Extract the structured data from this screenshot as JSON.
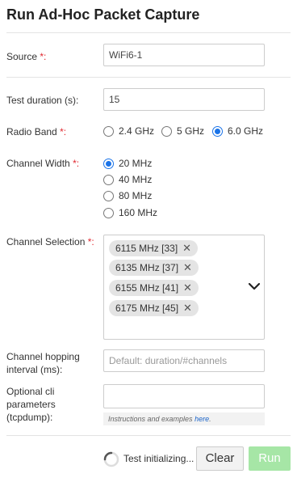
{
  "title": "Run Ad-Hoc Packet Capture",
  "source": {
    "label": "Source",
    "required_mark": "*:",
    "value": "WiFi6-1"
  },
  "duration": {
    "label": "Test duration (s):",
    "value": "15"
  },
  "radio_band": {
    "label": "Radio Band",
    "required_mark": "*:",
    "options": [
      {
        "label": "2.4 GHz",
        "checked": false
      },
      {
        "label": "5 GHz",
        "checked": false
      },
      {
        "label": "6.0 GHz",
        "checked": true
      }
    ]
  },
  "channel_width": {
    "label": "Channel Width",
    "required_mark": "*:",
    "options": [
      {
        "label": "20 MHz",
        "checked": true
      },
      {
        "label": "40 MHz",
        "checked": false
      },
      {
        "label": "80 MHz",
        "checked": false
      },
      {
        "label": "160 MHz",
        "checked": false
      }
    ]
  },
  "channel_selection": {
    "label": "Channel Selection",
    "required_mark": "*:",
    "chips": [
      "6115 MHz [33]",
      "6135 MHz [37]",
      "6155 MHz [41]",
      "6175 MHz [45]"
    ]
  },
  "hopping": {
    "label_line1": "Channel hopping",
    "label_line2": "interval (ms):",
    "placeholder": "Default: duration/#channels"
  },
  "cli": {
    "label_line1": "Optional cli",
    "label_line2": "parameters",
    "label_line3": "(tcpdump):",
    "value": "",
    "hint_text": "Instructions and examples ",
    "hint_link": "here",
    "hint_end": "."
  },
  "footer": {
    "status": "Test initializing...",
    "clear_label": "Clear",
    "run_label": "Run"
  },
  "colors": {
    "accent": "#1a73e8",
    "required": "#e0282f",
    "run_disabled": "#a6e6a6"
  },
  "icons": {
    "chip_remove": "close-icon",
    "dropdown": "chevron-down-icon",
    "loading": "spinner-icon"
  }
}
